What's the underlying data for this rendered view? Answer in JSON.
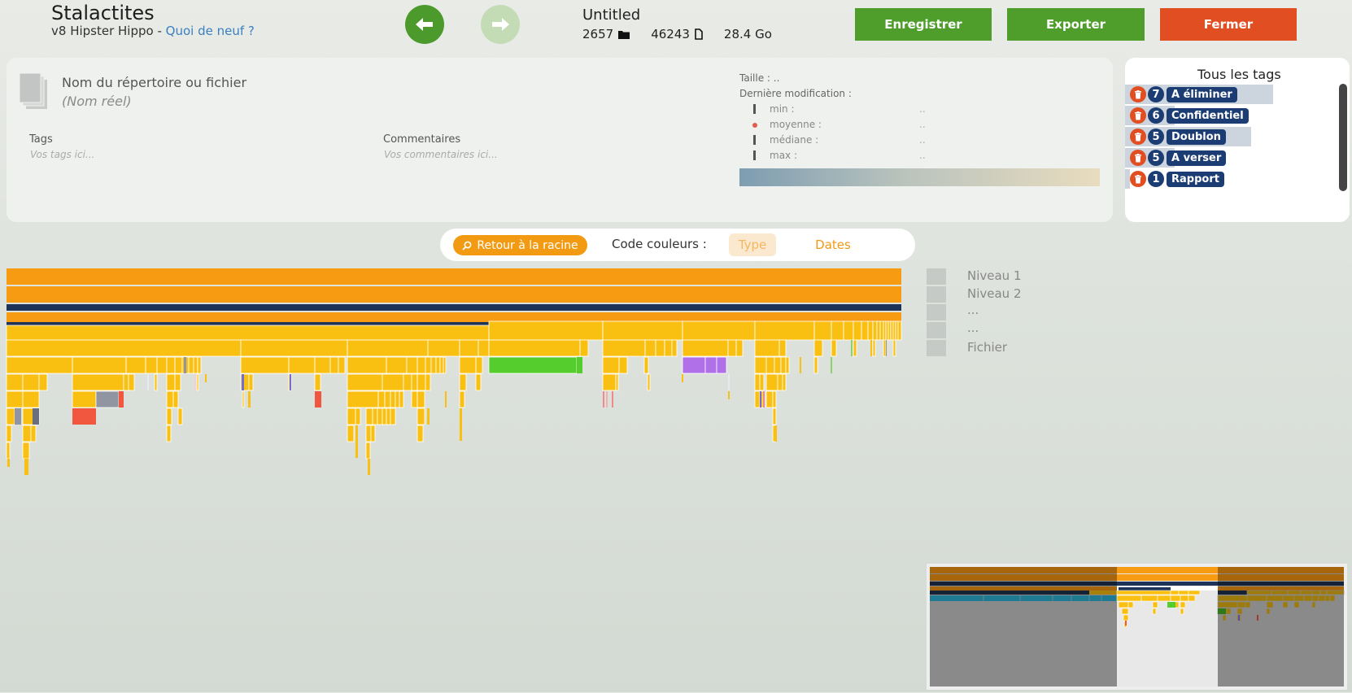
{
  "header": {
    "app_title": "Stalactites",
    "version": "v8 Hipster Hippo - ",
    "whats_new": "Quoi de neuf ?",
    "project_name": "Untitled",
    "folder_count": "2657",
    "file_count": "46243",
    "total_size": "28.4 Go",
    "save_label": "Enregistrer",
    "export_label": "Exporter",
    "close_label": "Fermer"
  },
  "info": {
    "name_placeholder": "Nom du répertoire ou fichier",
    "real_name": "(Nom réel)",
    "tags_label": "Tags",
    "tags_placeholder": "Vos tags ici...",
    "comments_label": "Commentaires",
    "comments_placeholder": "Vos commentaires ici...",
    "size_label": "Taille : ..",
    "last_modified_label": "Dernière modification :",
    "stats": [
      {
        "label": "min :",
        "value": "..",
        "marker": "tick"
      },
      {
        "label": "moyenne :",
        "value": "..",
        "marker": "dot"
      },
      {
        "label": "médiane :",
        "value": "..",
        "marker": "tick"
      },
      {
        "label": "max :",
        "value": "..",
        "marker": "tick"
      }
    ]
  },
  "tags": {
    "title": "Tous les tags",
    "items": [
      {
        "count": "7",
        "name": "A éliminer",
        "share": 0.66
      },
      {
        "count": "6",
        "name": "Confidentiel",
        "share": 0.22
      },
      {
        "count": "5",
        "name": "Doublon",
        "share": 0.56
      },
      {
        "count": "5",
        "name": "A verser",
        "share": 0.22
      },
      {
        "count": "1",
        "name": "Rapport",
        "share": 0.02
      }
    ]
  },
  "toolbar": {
    "root_label": "Retour à la racine",
    "color_code_label": "Code couleurs :",
    "type_label": "Type",
    "dates_label": "Dates"
  },
  "legend": {
    "levels": [
      "Niveau 1",
      "Niveau 2",
      "...",
      "...",
      "Fichier"
    ]
  },
  "colors": {
    "primary_green": "#4f9e2b",
    "danger_orange": "#e04e22",
    "accent_orange": "#f29a12",
    "folder_yellow": "#fac011",
    "tag_navy": "#1c3d73"
  }
}
